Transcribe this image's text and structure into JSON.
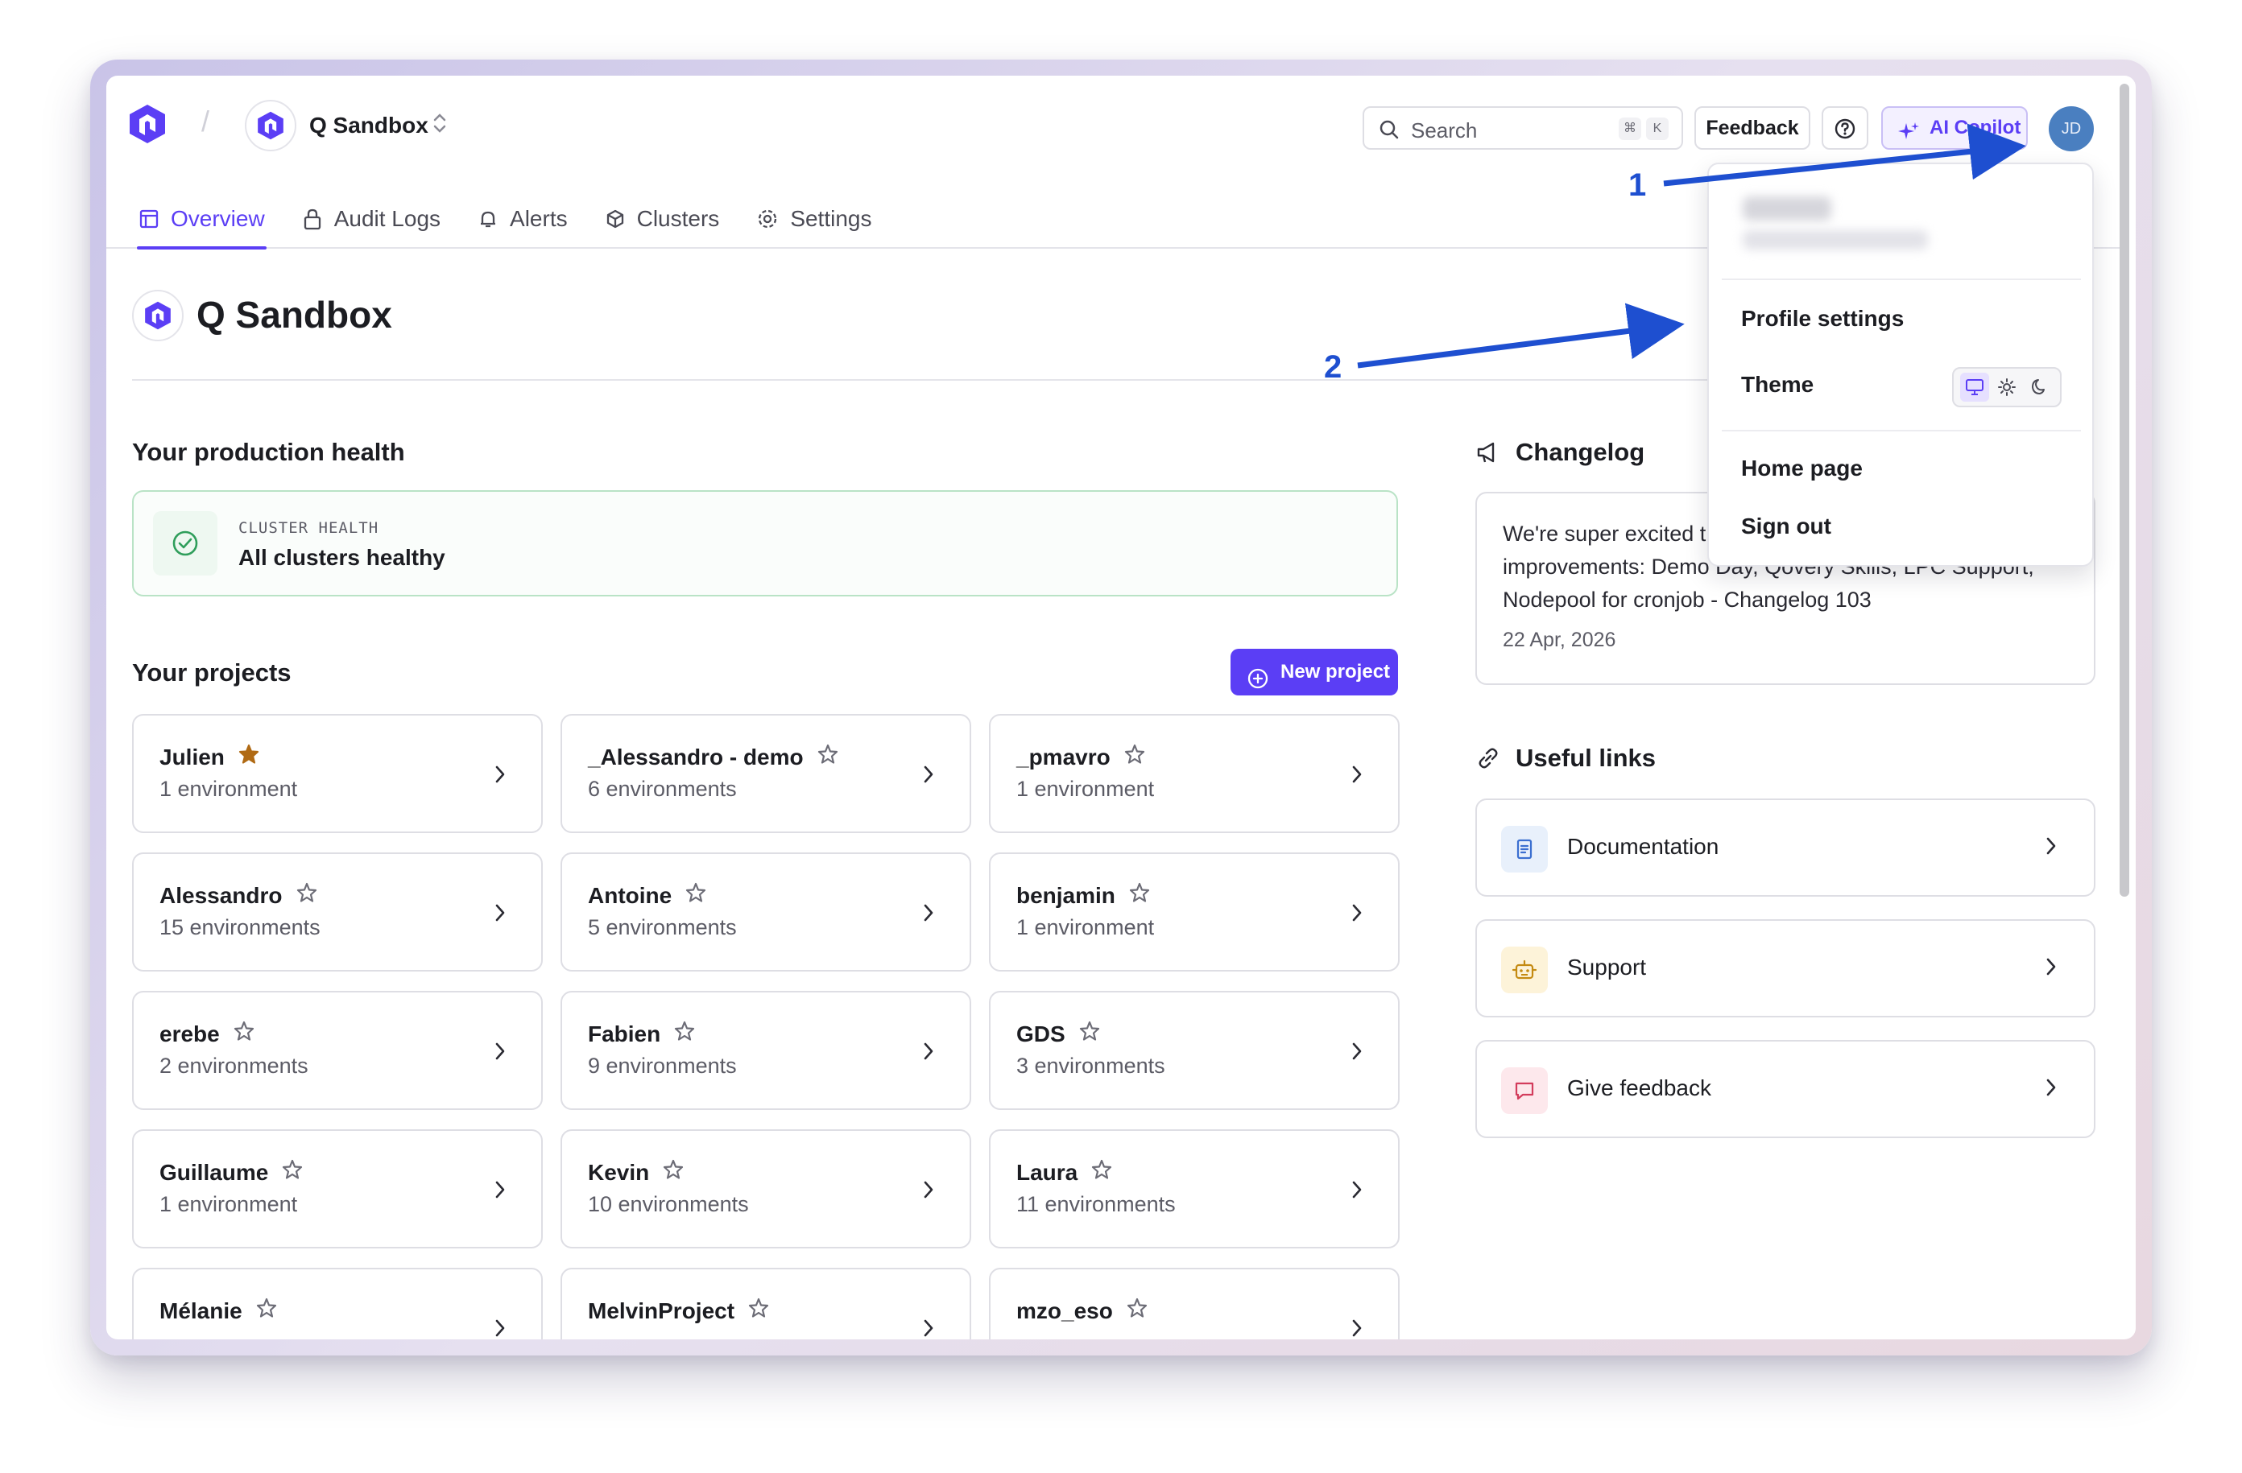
{
  "org": {
    "name": "Q Sandbox"
  },
  "search": {
    "placeholder": "Search",
    "shortcut_1": "⌘",
    "shortcut_2": "K"
  },
  "header": {
    "feedback_label": "Feedback",
    "copilot_label": "AI Copilot",
    "user_initials": "JD"
  },
  "tabs": [
    {
      "label": "Overview",
      "icon": "layout-icon",
      "active": true
    },
    {
      "label": "Audit Logs",
      "icon": "lock-icon"
    },
    {
      "label": "Alerts",
      "icon": "bell-icon"
    },
    {
      "label": "Clusters",
      "icon": "cube-icon"
    },
    {
      "label": "Settings",
      "icon": "gear-icon"
    }
  ],
  "page": {
    "title": "Q Sandbox"
  },
  "health": {
    "section_title": "Your production health",
    "label": "CLUSTER HEALTH",
    "value": "All clusters healthy"
  },
  "projects": {
    "section_title": "Your projects",
    "new_label": "New project",
    "items": [
      {
        "name": "Julien",
        "envs": "1 environment",
        "starred": true
      },
      {
        "name": "_Alessandro - demo",
        "envs": "6 environments",
        "starred": false
      },
      {
        "name": "_pmavro",
        "envs": "1 environment",
        "starred": false
      },
      {
        "name": "Alessandro",
        "envs": "15 environments",
        "starred": false
      },
      {
        "name": "Antoine",
        "envs": "5 environments",
        "starred": false
      },
      {
        "name": "benjamin",
        "envs": "1 environment",
        "starred": false
      },
      {
        "name": "erebe",
        "envs": "2 environments",
        "starred": false
      },
      {
        "name": "Fabien",
        "envs": "9 environments",
        "starred": false
      },
      {
        "name": "GDS",
        "envs": "3 environments",
        "starred": false
      },
      {
        "name": "Guillaume",
        "envs": "1 environment",
        "starred": false
      },
      {
        "name": "Kevin",
        "envs": "10 environments",
        "starred": false
      },
      {
        "name": "Laura",
        "envs": "11 environments",
        "starred": false
      },
      {
        "name": "Mélanie",
        "envs": "",
        "starred": false
      },
      {
        "name": "MelvinProject",
        "envs": "",
        "starred": false
      },
      {
        "name": "mzo_eso",
        "envs": "",
        "starred": false
      }
    ]
  },
  "changelog": {
    "title": "Changelog",
    "text": "We're super excited t... improvements: Demo Day, Qovery Skills, LPC Support, Nodepool for cronjob - Changelog 103",
    "line1": "We're super excited t",
    "line2": "improvements: Demo Day, Qovery Skills, LPC Support,",
    "line3": "Nodepool for cronjob - Changelog 103",
    "date": "22 Apr, 2026"
  },
  "useful_links": {
    "title": "Useful links",
    "items": [
      {
        "label": "Documentation",
        "icon": "document-icon",
        "color": "#e8f0fb"
      },
      {
        "label": "Support",
        "icon": "robot-icon",
        "color": "#fdf3d9"
      },
      {
        "label": "Give feedback",
        "icon": "message-icon",
        "color": "#fde8ec"
      }
    ]
  },
  "menu": {
    "profile_settings": "Profile settings",
    "theme": "Theme",
    "home_page": "Home page",
    "sign_out": "Sign out"
  },
  "annotations": {
    "step1": "1",
    "step2": "2",
    "color": "#1e4fd0"
  },
  "colors": {
    "accent": "#5b3ef5",
    "healthy": "#2f9e5b"
  }
}
